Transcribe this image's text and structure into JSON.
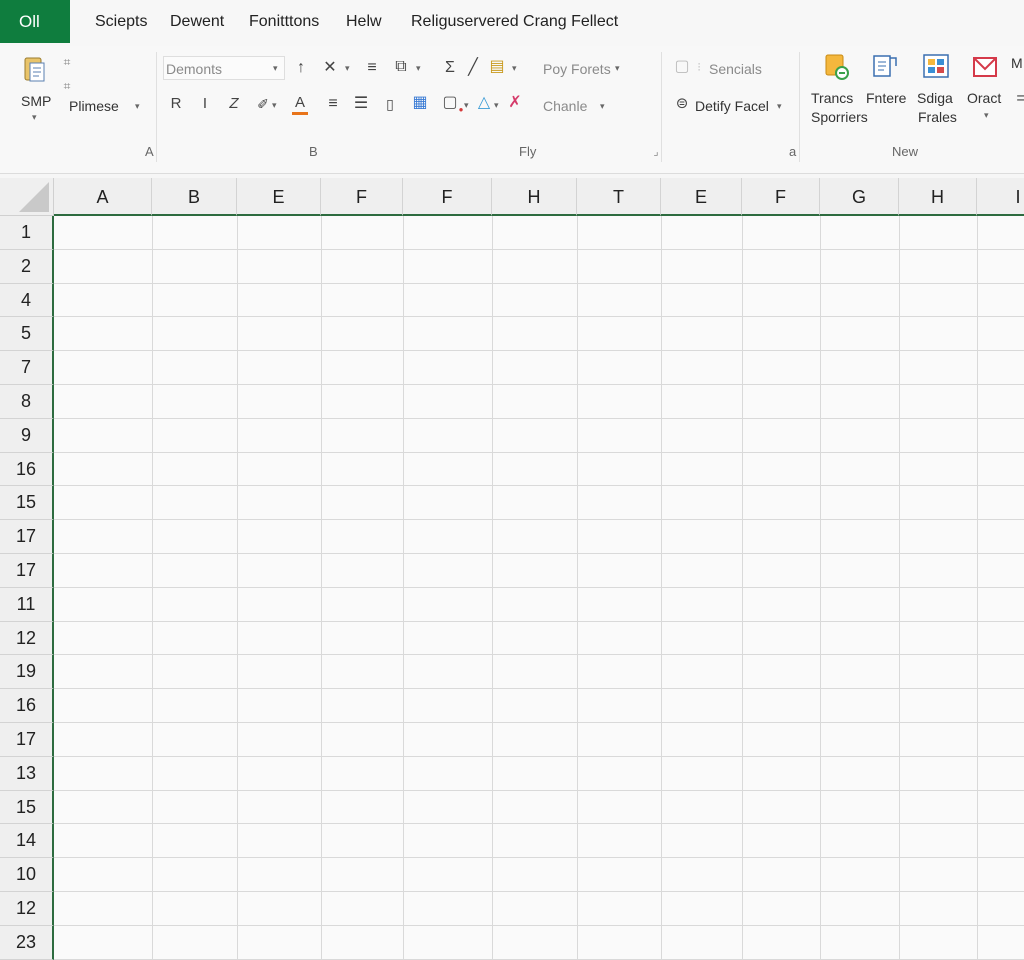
{
  "menubar": {
    "file_tab": "Oll",
    "items": [
      "Sciepts",
      "Dewent",
      "Fonitttons",
      "Helw",
      "Religuservered Crang Fellect"
    ]
  },
  "ribbon": {
    "clipboard": {
      "paste_label": "SMP",
      "group_label": "A",
      "format_label": "Plimese"
    },
    "font": {
      "font_name": "Demonts",
      "group_label": "B"
    },
    "alignment": {
      "style_combo": "Poy Forets",
      "style_combo2": "Chanle",
      "group_label": "Fly"
    },
    "cells": {
      "label1": "Sencials",
      "label2": "Detify Facel",
      "group_label": "a"
    },
    "new_group": {
      "buttons": [
        {
          "line1": "Trancs",
          "line2": "Sporriers"
        },
        {
          "line1": "Fntere",
          "line2": ""
        },
        {
          "line1": "Sdiga",
          "line2": "Frales"
        },
        {
          "line1": "Oract",
          "line2": ""
        }
      ],
      "extra": "M",
      "group_label": "New"
    },
    "colors": {
      "accent_green": "#0f7d3e",
      "font_color_bar": "#e8741a",
      "fill_yellow": "#f2c12e"
    }
  },
  "sheet": {
    "columns": [
      "A",
      "B",
      "E",
      "F",
      "F",
      "H",
      "T",
      "E",
      "F",
      "G",
      "H",
      "I"
    ],
    "rows": [
      "1",
      "2",
      "4",
      "5",
      "7",
      "8",
      "9",
      "16",
      "15",
      "17",
      "17",
      "11",
      "12",
      "19",
      "16",
      "17",
      "13",
      "15",
      "14",
      "10",
      "12",
      "23"
    ]
  }
}
